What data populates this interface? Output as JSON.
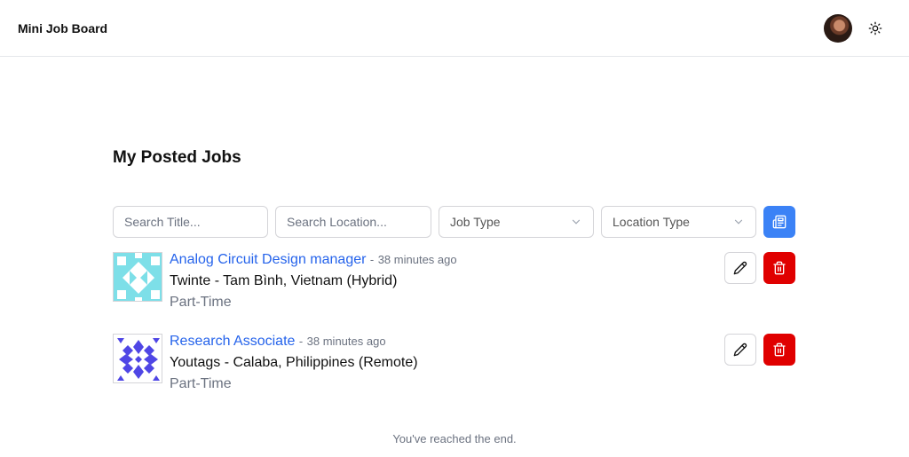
{
  "nav": {
    "brand": "Mini Job Board",
    "avatar_icon": "user-avatar",
    "theme_icon": "sun-icon"
  },
  "page": {
    "title": "My Posted Jobs"
  },
  "filters": {
    "search_title_placeholder": "Search Title...",
    "search_location_placeholder": "Search Location...",
    "job_type_label": "Job Type",
    "location_type_label": "Location Type",
    "apply_icon": "newspaper-icon"
  },
  "jobs": [
    {
      "title": "Analog Circuit Design manager",
      "separator": "-",
      "posted": "38 minutes ago",
      "company_location": "Twinte - Tam Bình, Vietnam (Hybrid)",
      "type": "Part-Time",
      "logo_color": "#7ddfe8"
    },
    {
      "title": "Research Associate",
      "separator": "-",
      "posted": "38 minutes ago",
      "company_location": "Youtags - Calaba, Philippines (Remote)",
      "type": "Part-Time",
      "logo_color": "#4f46e5"
    }
  ],
  "footer": {
    "end_message": "You've reached the end."
  },
  "colors": {
    "accent": "#3b82f6",
    "link": "#2563eb",
    "danger": "#e00000"
  }
}
